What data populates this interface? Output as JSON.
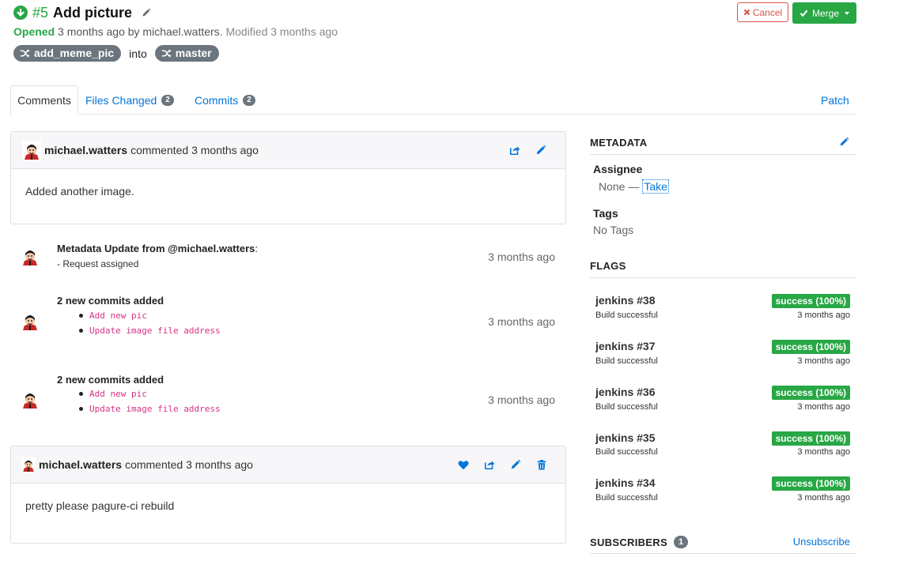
{
  "request": {
    "id": "#5",
    "title": "Add picture",
    "status": "Opened",
    "opened_text": "3 months ago by michael.watters.",
    "modified_text": "Modified 3 months ago",
    "source_branch": "add_meme_pic",
    "into_text": "into",
    "target_branch": "master"
  },
  "actions": {
    "cancel_label": "Cancel",
    "merge_label": "Merge"
  },
  "tabs": [
    {
      "label": "Comments"
    },
    {
      "label": "Files Changed",
      "count": "2"
    },
    {
      "label": "Commits",
      "count": "2"
    }
  ],
  "patch_label": "Patch",
  "comments": [
    {
      "user": "michael.watters",
      "when": "commented 3 months ago",
      "body": "Added another image."
    },
    {
      "user": "michael.watters",
      "when": "commented 3 months ago",
      "body": "pretty please pagure-ci rebuild"
    }
  ],
  "activity": [
    {
      "title": "Metadata Update from @michael.watters",
      "suffix": ":",
      "detail": "- Request assigned",
      "time": "3 months ago"
    },
    {
      "title": "2 new commits added",
      "commits": [
        "Add new pic",
        "Update image file address"
      ],
      "time": "3 months ago"
    },
    {
      "title": "2 new commits added",
      "commits": [
        "Add new pic",
        "Update image file address"
      ],
      "time": "3 months ago"
    }
  ],
  "sidebar": {
    "metadata_heading": "METADATA",
    "assignee_label": "Assignee",
    "assignee_value": "None —",
    "take_label": "Take",
    "tags_label": "Tags",
    "tags_value": "No Tags",
    "flags_heading": "FLAGS",
    "flags": [
      {
        "name": "jenkins #38",
        "desc": "Build successful",
        "status": "success (100%)",
        "time": "3 months ago"
      },
      {
        "name": "jenkins #37",
        "desc": "Build successful",
        "status": "success (100%)",
        "time": "3 months ago"
      },
      {
        "name": "jenkins #36",
        "desc": "Build successful",
        "status": "success (100%)",
        "time": "3 months ago"
      },
      {
        "name": "jenkins #35",
        "desc": "Build successful",
        "status": "success (100%)",
        "time": "3 months ago"
      },
      {
        "name": "jenkins #34",
        "desc": "Build successful",
        "status": "success (100%)",
        "time": "3 months ago"
      }
    ],
    "subscribers_heading": "SUBSCRIBERS",
    "subscribers_count": "1",
    "unsubscribe_label": "Unsubscribe"
  },
  "colors": {
    "success": "#28a745",
    "link": "#0275d8",
    "danger": "#d9534f",
    "badge": "#6c757d",
    "commit": "#d63384"
  },
  "icons": [
    "check-circle-icon",
    "pencil-icon",
    "shuffle-icon",
    "times-icon",
    "check-icon",
    "share-icon",
    "heart-icon",
    "trash-icon"
  ]
}
